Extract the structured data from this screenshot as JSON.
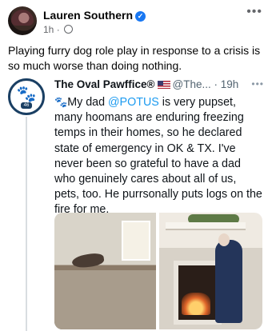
{
  "post": {
    "author": "Lauren Southern",
    "time": "1h",
    "separator": "·",
    "caption": "Playing furry dog role play in response to a crisis is so much worse than doing nothing."
  },
  "tweet": {
    "name": "The Oval Pawffice®",
    "handle": "@The...",
    "time": "· 19h",
    "text_intro": "My dad ",
    "mention": "@POTUS",
    "text_body": " is very pupset, many hoomans are enduring freezing temps in their homes, so he declared state of emergency in OK & TX. I've never been so grateful to have a dad who genuinely cares about all of us, pets, too. He purrsonally puts logs on the fire for me.",
    "avatar_badge": "46"
  },
  "colors": {
    "verified": "#1877f2",
    "mention": "#1d9bf0",
    "secondary_text": "#65676b",
    "tweet_avatar_ring": "#1a3f63"
  },
  "icons": {
    "verified": "verified-badge-icon",
    "audience": "globe-icon",
    "more": "more-options-icon",
    "flag": "us-flag-icon",
    "paw": "paw-print-icon"
  }
}
